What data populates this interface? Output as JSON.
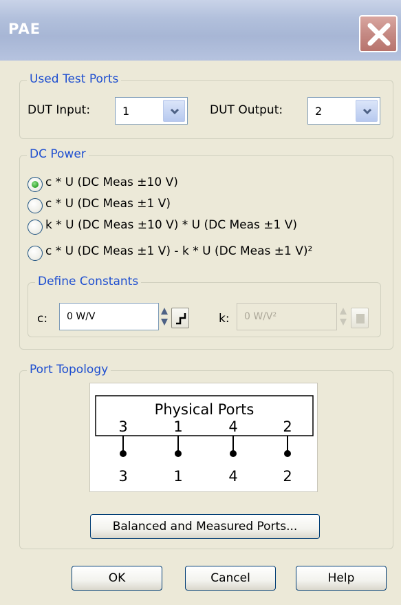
{
  "window": {
    "title": "PAE"
  },
  "used_test_ports": {
    "label": "Used Test Ports",
    "dut_input_label": "DUT Input:",
    "dut_input_value": "1",
    "dut_output_label": "DUT Output:",
    "dut_output_value": "2"
  },
  "dc_power": {
    "label": "DC Power",
    "options": [
      {
        "label": "c * U (DC Meas ±10 V)",
        "selected": true
      },
      {
        "label": "c * U (DC Meas ±1 V)",
        "selected": false
      },
      {
        "label": "k * U (DC Meas ±10 V) * U (DC Meas ±1 V)",
        "selected": false
      },
      {
        "label": "c * U (DC Meas ±1 V)  -  k * U (DC Meas ±1 V)²",
        "selected": false
      }
    ],
    "define_constants": {
      "label": "Define Constants",
      "c_label": "c:",
      "c_value": "0 W/V",
      "k_label": "k:",
      "k_value": "0 W/V²"
    }
  },
  "port_topology": {
    "label": "Port Topology",
    "diagram": {
      "title": "Physical Ports",
      "physical_ports": [
        "3",
        "1",
        "4",
        "2"
      ],
      "logical_ports": [
        "3",
        "1",
        "4",
        "2"
      ]
    },
    "balanced_button": "Balanced and Measured Ports..."
  },
  "buttons": {
    "ok": "OK",
    "cancel": "Cancel",
    "help": "Help"
  }
}
